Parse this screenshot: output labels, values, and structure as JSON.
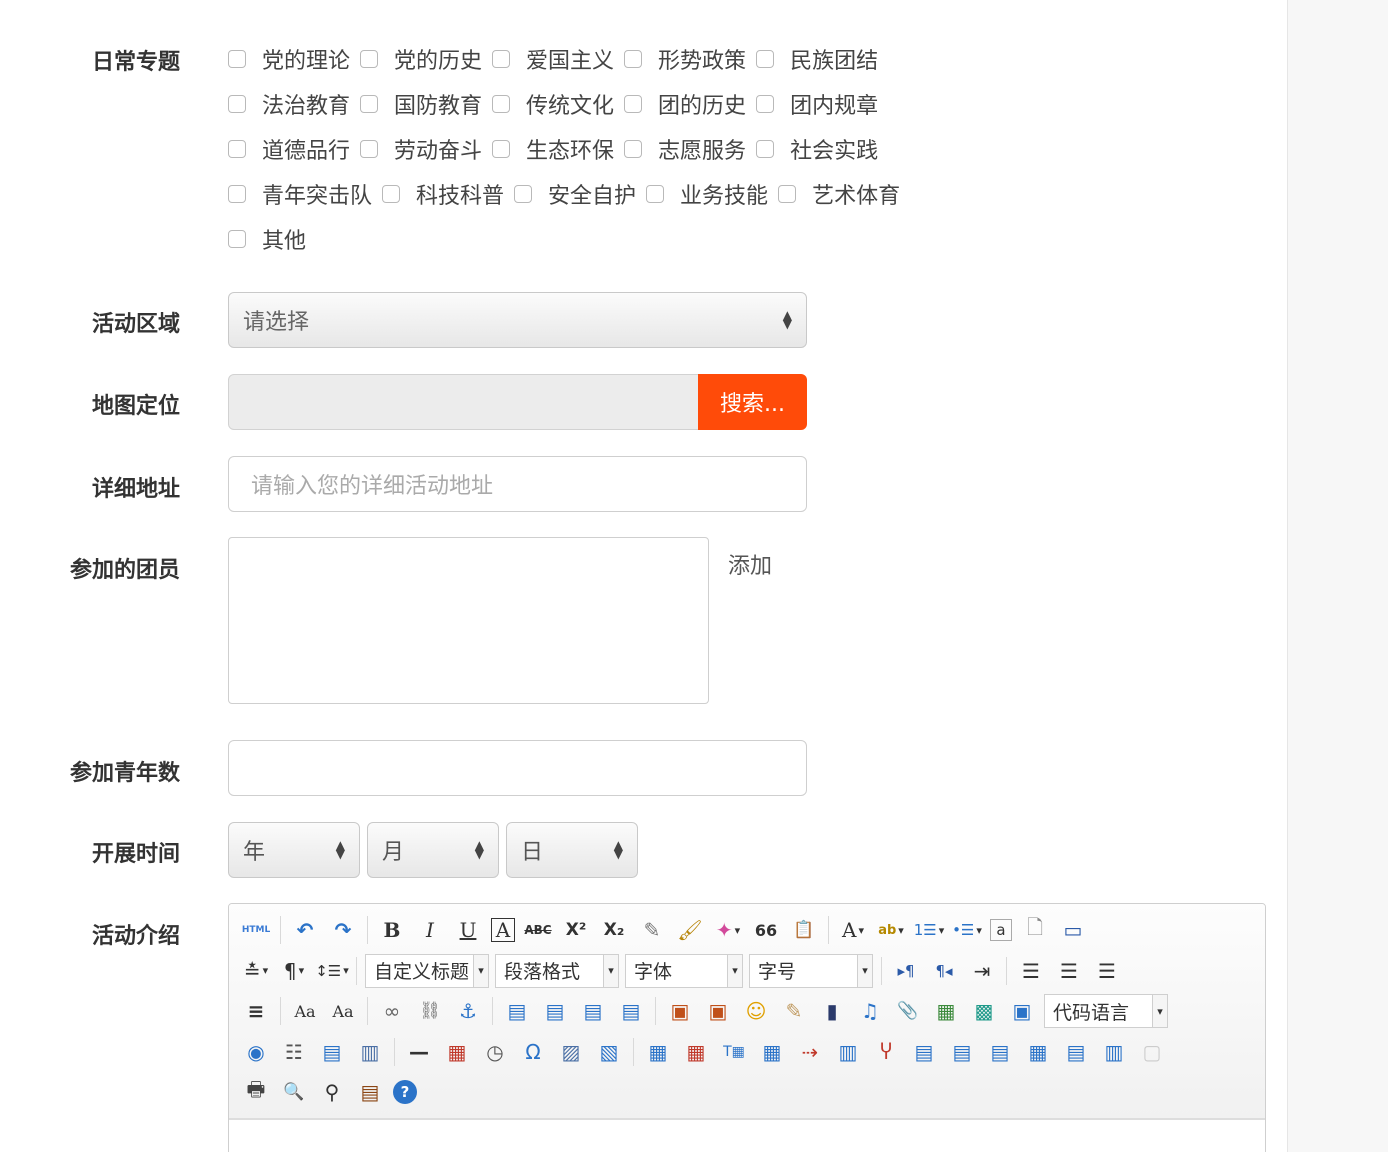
{
  "labels": {
    "topics": "日常专题",
    "region": "活动区域",
    "map": "地图定位",
    "address": "详细地址",
    "members": "参加的团员",
    "youth_count": "参加青年数",
    "date": "开展时间",
    "intro": "活动介绍"
  },
  "topics": [
    [
      "党的理论",
      "党的历史",
      "爱国主义",
      "形势政策",
      "民族团结"
    ],
    [
      "法治教育",
      "国防教育",
      "传统文化",
      "团的历史",
      "团内规章"
    ],
    [
      "道德品行",
      "劳动奋斗",
      "生态环保",
      "志愿服务",
      "社会实践"
    ],
    [
      "青年突击队",
      "科技科普",
      "安全自护",
      "业务技能",
      "艺术体育"
    ],
    [
      "其他"
    ]
  ],
  "region_select": {
    "selected": "请选择"
  },
  "map": {
    "search_label": "搜索..."
  },
  "address": {
    "placeholder": "请输入您的详细活动地址"
  },
  "members": {
    "add_label": "添加"
  },
  "date": {
    "year": "年",
    "month": "月",
    "day": "日"
  },
  "editor": {
    "combos": {
      "heading": "自定义标题",
      "paragraph": "段落格式",
      "font": "字体",
      "size": "字号",
      "code": "代码语言"
    },
    "glyphs": {
      "html": "HTML",
      "undo": "↶",
      "redo": "↷",
      "bold": "B",
      "italic": "I",
      "underline": "U",
      "border": "A",
      "strike": "ABC",
      "sup": "X²",
      "sub": "X₂",
      "eraser": "✎",
      "brush": "🖌",
      "magic": "✦",
      "quote": "66",
      "paste": "📋",
      "fontcolor": "A",
      "highlight": "ab",
      "olist": "1☰",
      "ulist": "•☰",
      "text": "a",
      "page": "🗋",
      "preview": "▭",
      "rowspace": "≛",
      "paragraph": "¶",
      "lineheight": "↕☰",
      "ltr": "▸¶",
      "rtl": "¶◂",
      "indent": "⇥",
      "alignl": "☰",
      "alignc": "☰",
      "alignr": "☰",
      "justify": "≡",
      "case1": "Aa",
      "case2": "Aa",
      "link": "∞",
      "unlink": "⛓",
      "anchor": "⚓",
      "imgleft": "▤",
      "imgright": "▤",
      "imgnone": "▤",
      "imgcenter": "▤",
      "image": "▣",
      "multiimg": "▣",
      "emotion": "☺",
      "scrawl": "✎",
      "video": "▮",
      "music": "♫",
      "attach": "📎",
      "map": "▦",
      "gmap": "▩",
      "frame": "▣",
      "webapp": "◉",
      "pagebreak": "☷",
      "template": "▤",
      "bg": "▥",
      "hr": "—",
      "date": "▦",
      "time": "◷",
      "char": "Ω",
      "wordimg": "▨",
      "wordfile": "▧",
      "table": "▦",
      "deltable": "▦",
      "caption": "T▦",
      "row": "▦",
      "col": "⇢",
      "mergecell": "▥",
      "splitcell": "Ⴤ",
      "t1": "▤",
      "t2": "▤",
      "t3": "▤",
      "t4": "▦",
      "t5": "▤",
      "t6": "▥",
      "t7": "▢",
      "print": "🖶",
      "search": "🔍",
      "replace": "⚲",
      "draft": "▤",
      "help": "?"
    }
  },
  "colors": {
    "accent": "#ff4b09",
    "border": "#cfcfcf"
  }
}
